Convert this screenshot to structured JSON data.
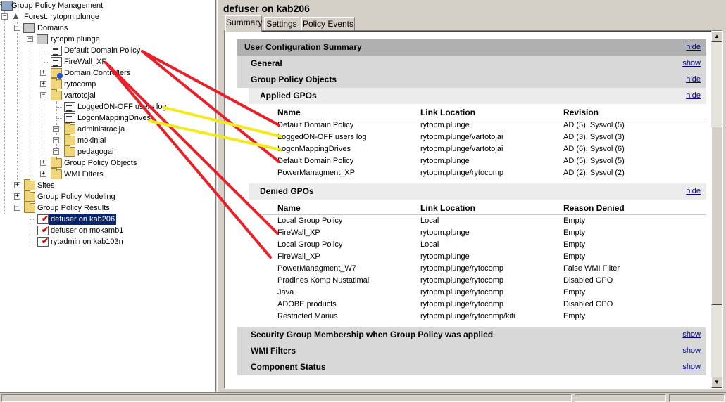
{
  "tree": {
    "root": "Group Policy Management",
    "forest": "Forest: rytopm.plunge",
    "domains": "Domains",
    "domain": "rytopm.plunge",
    "default_domain_policy": "Default Domain Policy",
    "firewall_xp": "FireWall_XP",
    "domain_controllers": "Domain Controllers",
    "rytocomp": "rytocomp",
    "vartotojai": "vartotojai",
    "loggedon": "LoggedON-OFF users log",
    "logonmapping": "LogonMappingDrives",
    "administracija": "administracija",
    "mokiniai": "mokiniai",
    "pedagogai": "pedagogai",
    "gpo_objects": "Group Policy Objects",
    "wmi_filters": "WMI Filters",
    "sites": "Sites",
    "modeling": "Group Policy Modeling",
    "results": "Group Policy Results",
    "result1": "defuser on kab206",
    "result2": "defuser on mokamb1",
    "result3": "rytadmin on kab103n"
  },
  "report": {
    "title": "defuser on kab206",
    "tabs": [
      "Summary",
      "Settings",
      "Policy Events"
    ],
    "user_config": "User Configuration Summary",
    "general": "General",
    "gpo": "Group Policy Objects",
    "applied": "Applied GPOs",
    "denied": "Denied GPOs",
    "security": "Security Group Membership when Group Policy was applied",
    "wmi": "WMI Filters",
    "component": "Component Status",
    "hide": "hide",
    "show": "show",
    "applied_headers": [
      "Name",
      "Link Location",
      "Revision"
    ],
    "applied_rows": [
      [
        "Default Domain Policy",
        "rytopm.plunge",
        "AD (5), Sysvol (5)"
      ],
      [
        "LoggedON-OFF users log",
        "rytopm.plunge/vartotojai",
        "AD (3), Sysvol (3)"
      ],
      [
        "LogonMappingDrives",
        "rytopm.plunge/vartotojai",
        "AD (6), Sysvol (6)"
      ],
      [
        "Default Domain Policy",
        "rytopm.plunge",
        "AD (5), Sysvol (5)"
      ],
      [
        "PowerManagment_XP",
        "rytopm.plunge/rytocomp",
        "AD (2), Sysvol (2)"
      ]
    ],
    "denied_headers": [
      "Name",
      "Link Location",
      "Reason Denied"
    ],
    "denied_rows": [
      [
        "Local Group Policy",
        "Local",
        "Empty"
      ],
      [
        "FireWall_XP",
        "rytopm.plunge",
        "Empty"
      ],
      [
        "Local Group Policy",
        "Local",
        "Empty"
      ],
      [
        "FireWall_XP",
        "rytopm.plunge",
        "Empty"
      ],
      [
        "PowerManagment_W7",
        "rytopm.plunge/rytocomp",
        "False WMI Filter"
      ],
      [
        "Pradines Komp Nustatimai",
        "rytopm.plunge/rytocomp",
        "Disabled GPO"
      ],
      [
        "Java",
        "rytopm.plunge/rytocomp",
        "Empty"
      ],
      [
        "ADOBE products",
        "rytopm.plunge/rytocomp",
        "Disabled GPO"
      ],
      [
        "Restricted Marius",
        "rytopm.plunge/rytocomp/kiti",
        "Empty"
      ]
    ]
  },
  "colors": {
    "red_annotation": "#e8202a",
    "yellow_annotation": "#f2ea1c",
    "selection": "#0a246a"
  }
}
